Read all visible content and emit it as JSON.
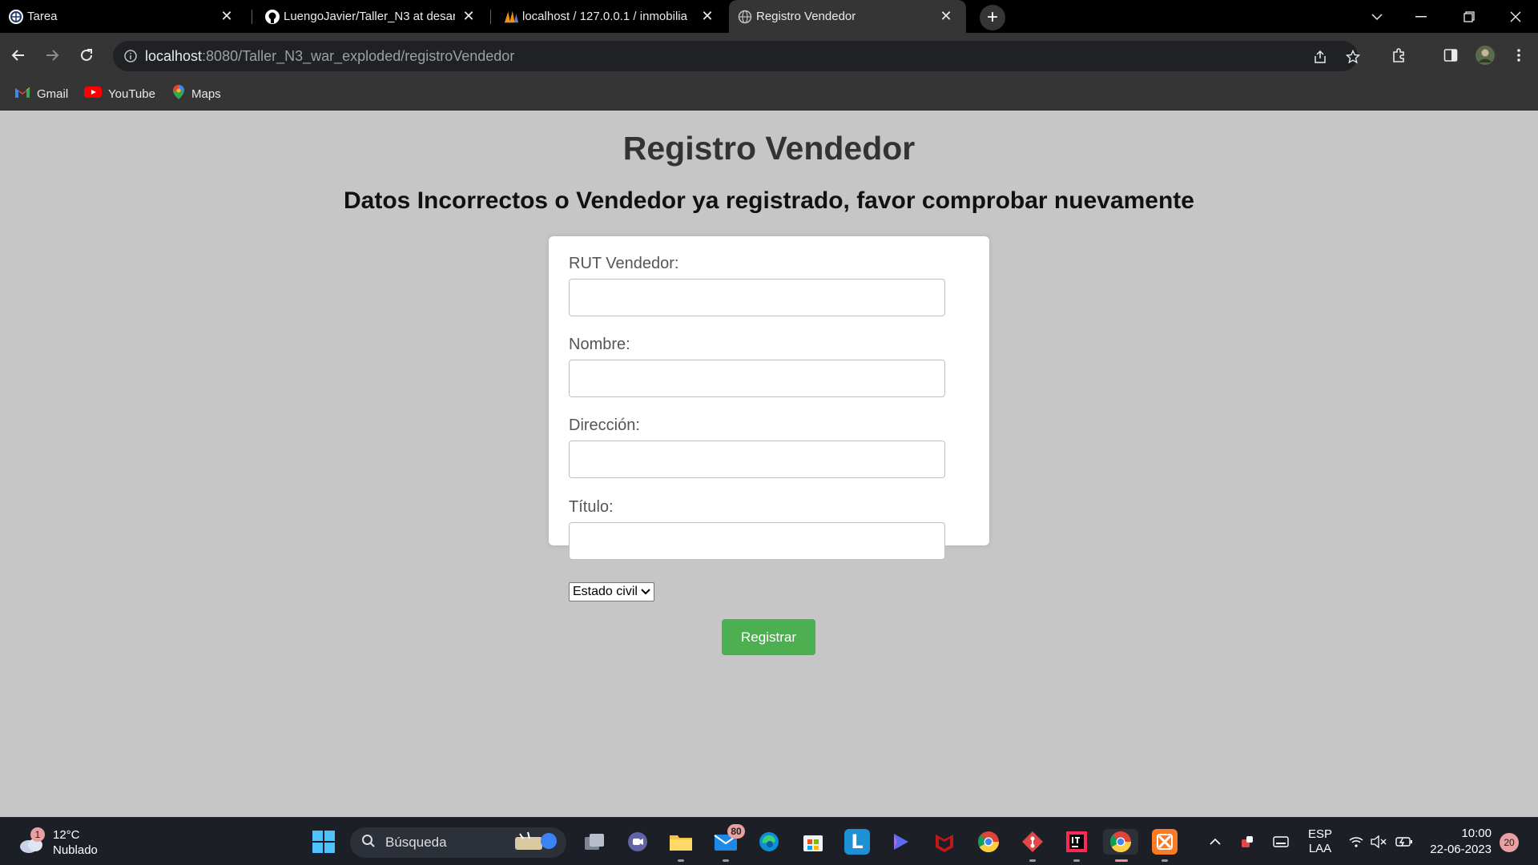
{
  "browser": {
    "tabs": [
      {
        "title": "Tarea",
        "icon": "moodle-icon"
      },
      {
        "title": "LuengoJavier/Taller_N3 at desar",
        "icon": "github-icon"
      },
      {
        "title": "localhost / 127.0.0.1 / inmobilia",
        "icon": "phpmyadmin-icon"
      },
      {
        "title": "Registro Vendedor",
        "icon": "globe-icon",
        "active": true
      }
    ],
    "url_host": "localhost",
    "url_rest": ":8080/Taller_N3_war_exploded/registroVendedor",
    "bookmarks": [
      {
        "label": "Gmail",
        "icon": "gmail-icon"
      },
      {
        "label": "YouTube",
        "icon": "youtube-icon"
      },
      {
        "label": "Maps",
        "icon": "maps-icon"
      }
    ]
  },
  "page": {
    "title": "Registro Vendedor",
    "error_message": "Datos Incorrectos o Vendedor ya registrado, favor comprobar nuevamente",
    "form": {
      "rut_label": "RUT Vendedor:",
      "rut_value": "",
      "nombre_label": "Nombre:",
      "nombre_value": "",
      "direccion_label": "Dirección:",
      "direccion_value": "",
      "titulo_label": "Título:",
      "titulo_value": "",
      "estado_civil_selected": "Estado civil",
      "submit_label": "Registrar",
      "submit_color": "#4caf50"
    }
  },
  "taskbar": {
    "weather_temp": "12°C",
    "weather_desc": "Nublado",
    "weather_badge": "1",
    "search_placeholder": "Búsqueda",
    "mail_badge": "80",
    "lang_top": "ESP",
    "lang_bottom": "LAA",
    "time": "10:00",
    "date": "22-06-2023",
    "notifications": "20"
  }
}
